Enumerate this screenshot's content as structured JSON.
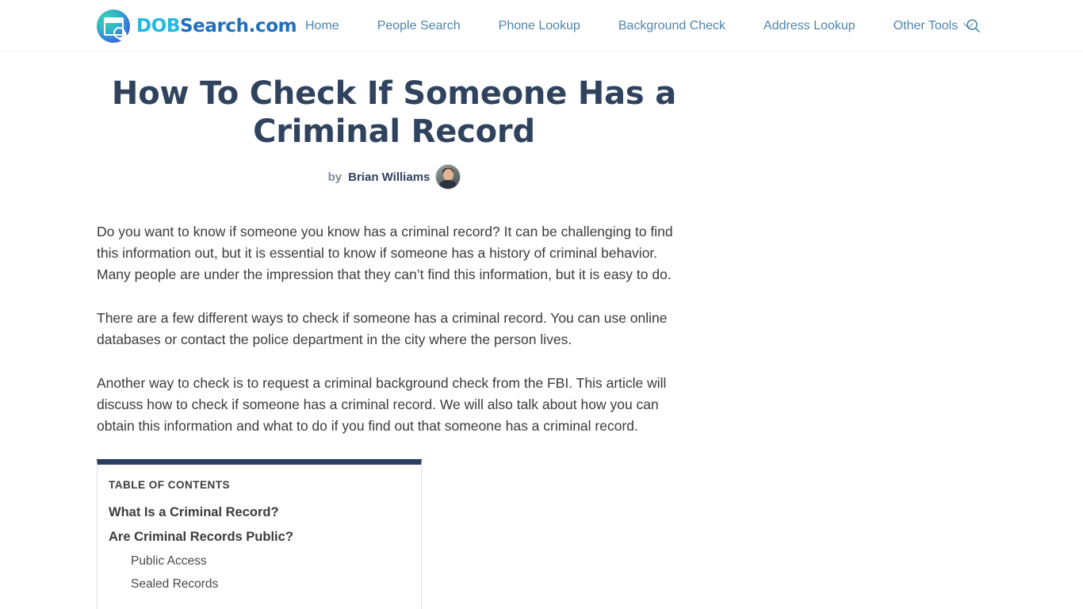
{
  "header": {
    "logo": {
      "icon": "calendar-search-icon",
      "text_primary": "DOB",
      "text_secondary": "Search.com"
    },
    "nav": [
      {
        "label": "Home",
        "has_dropdown": false
      },
      {
        "label": "People Search",
        "has_dropdown": false
      },
      {
        "label": "Phone Lookup",
        "has_dropdown": false
      },
      {
        "label": "Background Check",
        "has_dropdown": false
      },
      {
        "label": "Address Lookup",
        "has_dropdown": false
      },
      {
        "label": "Other Tools",
        "has_dropdown": true
      }
    ],
    "search_icon": "search-icon"
  },
  "article": {
    "title": "How To Check If Someone Has a Criminal Record",
    "byline": {
      "by_label": "by",
      "author": "Brian Williams",
      "avatar": "author-avatar"
    },
    "paragraphs": [
      "Do you want to know if someone you know has a criminal record? It can be challenging to find this information out, but it is essential to know if someone has a history of criminal behavior. Many people are under the impression that they can’t find this information, but it is easy to do.",
      "There are a few different ways to check if someone has a criminal record. You can use online databases or contact the police department in the city where the person lives.",
      "Another way to check is to request a criminal background check from the FBI. This article will discuss how to check if someone has a criminal record. We will also talk about how you can obtain this information and what to do if you find out that someone has a criminal record."
    ]
  },
  "toc": {
    "title": "TABLE OF CONTENTS",
    "items": [
      {
        "label": "What Is a Criminal Record?",
        "level": 1
      },
      {
        "label": "Are Criminal Records Public?",
        "level": 1
      },
      {
        "label": "Public Access",
        "level": 2
      },
      {
        "label": "Sealed Records",
        "level": 2
      }
    ]
  },
  "colors": {
    "nav_link": "#4f85ab",
    "title": "#30435e",
    "toc_accent": "#2c3e5d",
    "logo_primary": "#22b8e0",
    "logo_secondary": "#1f6fbd"
  }
}
